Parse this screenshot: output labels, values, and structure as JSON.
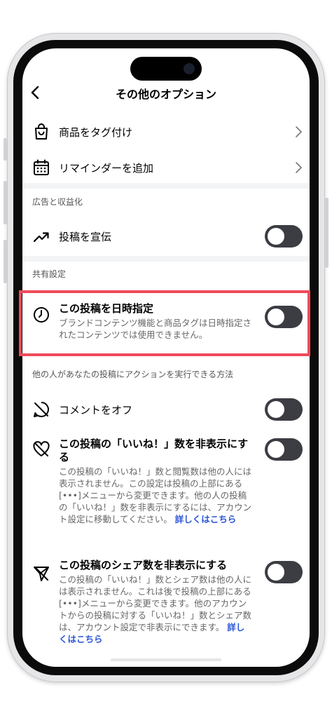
{
  "nav": {
    "title": "その他のオプション"
  },
  "items": {
    "tag_products": "商品をタグ付け",
    "add_reminder": "リマインダーを追加"
  },
  "sections": {
    "ads": {
      "header": "広告と収益化",
      "promote": "投稿を宣伝"
    },
    "sharing": {
      "header": "共有設定",
      "schedule_title": "この投稿を日時指定",
      "schedule_desc": "ブランドコンテンツ機能と商品タグは日時指定されたコンテンツでは使用できません。"
    },
    "actions": {
      "header": "他の人があなたの投稿にアクションを実行できる方法",
      "comments_off": "コメントをオフ",
      "hide_likes_title": "この投稿の「いいね！」数を非表示にする",
      "hide_likes_desc": "この投稿の「いいね！」数と閲覧数は他の人には表示されません。この設定は投稿の上部にある[•••]メニューから変更できます。他の人の投稿の「いいね！」数を非表示にするには、アカウント設定に移動してください。",
      "hide_likes_link": "詳しくはこちら",
      "hide_shares_title": "この投稿のシェア数を非表示にする",
      "hide_shares_desc": "この投稿の「いいね！」数とシェア数は他の人には表示されません。これは後で投稿の上部にある[•••]メニューから変更できます。他のアカウントからの投稿に対する「いいね！」数とシェア数は、アカウント設定で非表示にできます。",
      "hide_shares_link": "詳しくはこちら"
    }
  },
  "toggles": {
    "promote": false,
    "schedule": false,
    "comments_off": false,
    "hide_likes": false,
    "hide_shares": false
  },
  "colors": {
    "highlight": "#ef4a5a",
    "toggle_off": "#3c3c43",
    "link": "#2b56d9"
  }
}
